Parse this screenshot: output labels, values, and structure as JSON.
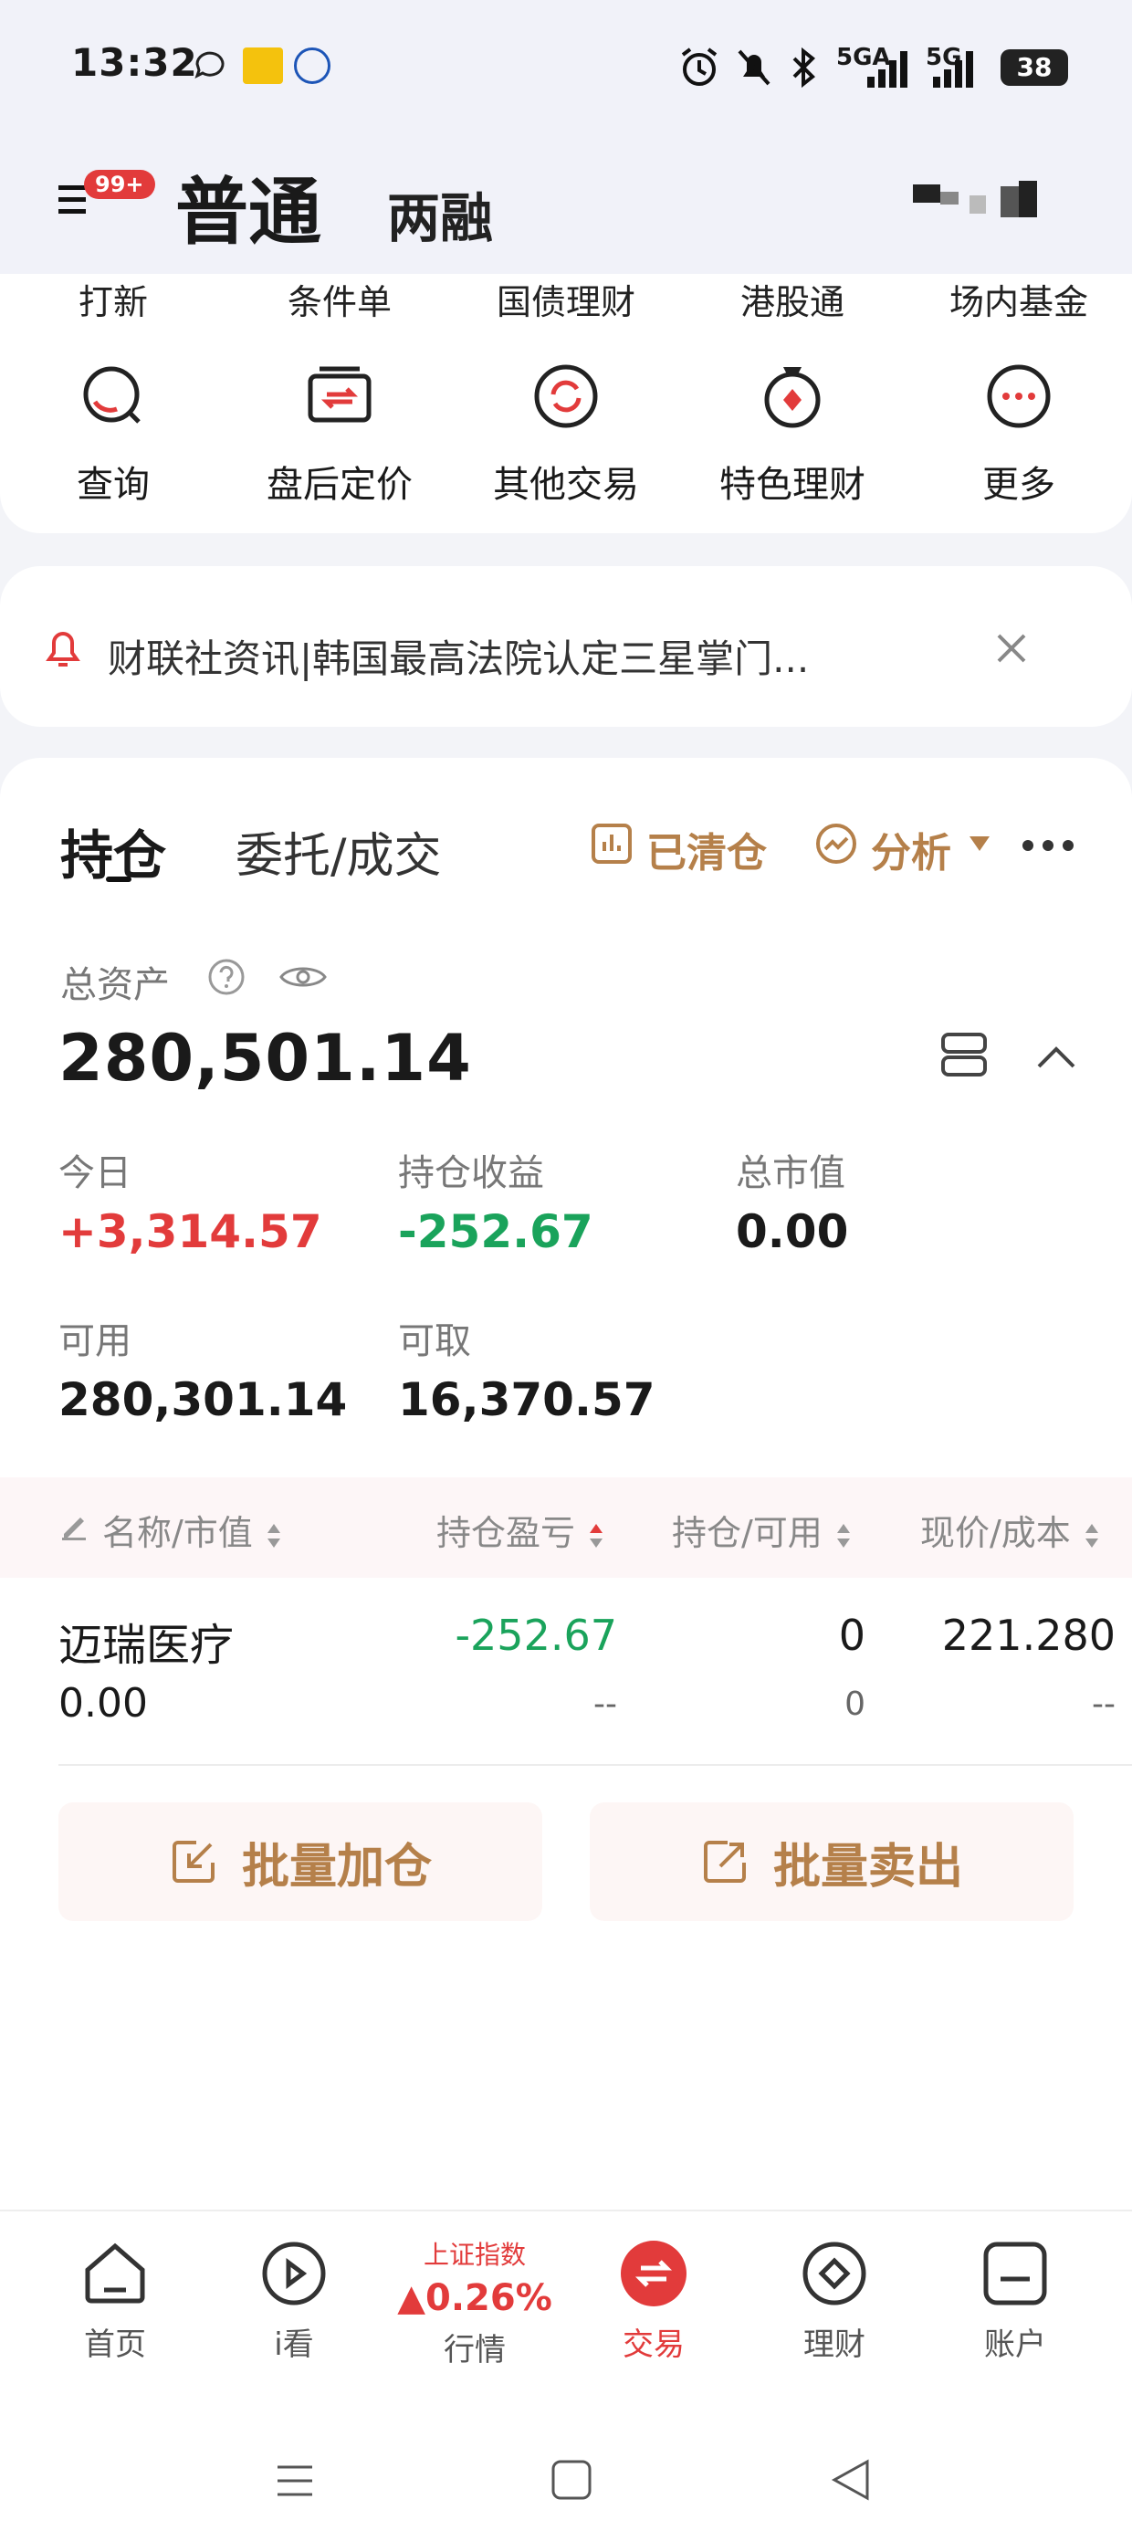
{
  "status_bar": {
    "time": "13:32",
    "network_1": "5GA",
    "network_2": "5G",
    "battery": "38"
  },
  "header": {
    "badge": "99+",
    "tab_normal": "普通",
    "tab_margin": "两融"
  },
  "quick_menu": {
    "top_items": [
      "打新",
      "条件单",
      "国债理财",
      "港股通",
      "场内基金"
    ],
    "icon_items": [
      {
        "label": "查询",
        "icon": "search-icon"
      },
      {
        "label": "盘后定价",
        "icon": "after-hours-icon"
      },
      {
        "label": "其他交易",
        "icon": "exchange-icon"
      },
      {
        "label": "特色理财",
        "icon": "medal-icon"
      },
      {
        "label": "更多",
        "icon": "more-icon"
      }
    ]
  },
  "news": {
    "text": "财联社资讯|韩国最高法院认定三星掌门..."
  },
  "positions": {
    "tab_hold": "持仓",
    "tab_order": "委托/成交",
    "cleared_label": "已清仓",
    "analysis_label": "分析",
    "total_assets_label": "总资产",
    "total_assets_value": "280,501.14",
    "stats": [
      {
        "label": "今日",
        "value": "+3,314.57",
        "tone": "red"
      },
      {
        "label": "持仓收益",
        "value": "-252.67",
        "tone": "green"
      },
      {
        "label": "总市值",
        "value": "0.00",
        "tone": "black"
      },
      {
        "label": "可用",
        "value": "280,301.14",
        "tone": "black"
      },
      {
        "label": "可取",
        "value": "16,370.57",
        "tone": "black"
      }
    ],
    "columns": [
      "名称/市值",
      "持仓盈亏",
      "持仓/可用",
      "现价/成本"
    ],
    "rows": [
      {
        "name": "迈瑞医疗",
        "market_value": "0.00",
        "pnl": "-252.67",
        "pnl_sub": "--",
        "hold": "0",
        "available": "0",
        "price": "221.280",
        "cost": "--"
      }
    ],
    "batch_add": "批量加仓",
    "batch_sell": "批量卖出"
  },
  "bottom_nav": {
    "items": [
      {
        "label": "首页",
        "icon": "home-icon"
      },
      {
        "label": "i看",
        "icon": "play-icon"
      },
      {
        "label": "行情",
        "icon": "market-icon"
      },
      {
        "label": "交易",
        "icon": "trade-icon"
      },
      {
        "label": "理财",
        "icon": "wealth-icon"
      },
      {
        "label": "账户",
        "icon": "account-icon"
      }
    ],
    "market_index_name": "上证指数",
    "market_index_change": "▲0.26%"
  },
  "colors": {
    "accent_red": "#e23b3b",
    "gain_green": "#1aa35b",
    "gold": "#b5804a"
  }
}
